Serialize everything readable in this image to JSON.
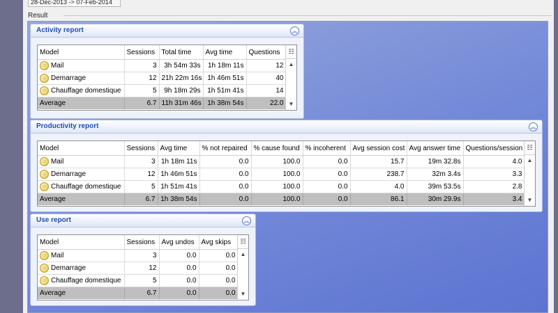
{
  "date_range": "28-Dec-2013 -> 07-Feb-2014",
  "result_label": "Result",
  "icons": {
    "collapse": "double-chevron-up-icon",
    "column_chooser": "column-chooser-icon",
    "model": "model-icon",
    "scroll_up": "arrow-up-icon",
    "scroll_down": "arrow-down-icon"
  },
  "activity": {
    "title": "Activity report",
    "columns": [
      "Model",
      "Sessions",
      "Total time",
      "Avg time",
      "Questions"
    ],
    "rows": [
      [
        "Mail",
        "3",
        "3h 54m 33s",
        "1h 18m 11s",
        "12"
      ],
      [
        "Demarrage",
        "12",
        "21h 22m 16s",
        "1h 46m 51s",
        "40"
      ],
      [
        "Chauffage domestique",
        "5",
        "9h 18m 29s",
        "1h 51m 41s",
        "14"
      ]
    ],
    "average": [
      "Average",
      "6.7",
      "11h 31m 46s",
      "1h 38m 54s",
      "22.0"
    ]
  },
  "productivity": {
    "title": "Productivity report",
    "columns": [
      "Model",
      "Sessions",
      "Avg time",
      "% not repaired",
      "% cause found",
      "% incoherent",
      "Avg session cost",
      "Avg answer time",
      "Questions/session"
    ],
    "rows": [
      [
        "Mail",
        "3",
        "1h 18m 11s",
        "0.0",
        "100.0",
        "0.0",
        "15.7",
        "19m 32.8s",
        "4.0"
      ],
      [
        "Demarrage",
        "12",
        "1h 46m 51s",
        "0.0",
        "100.0",
        "0.0",
        "238.7",
        "32m 3.4s",
        "3.3"
      ],
      [
        "Chauffage domestique",
        "5",
        "1h 51m 41s",
        "0.0",
        "100.0",
        "0.0",
        "4.0",
        "39m 53.5s",
        "2.8"
      ]
    ],
    "average": [
      "Average",
      "6.7",
      "1h 38m 54s",
      "0.0",
      "100.0",
      "0.0",
      "86.1",
      "30m 29.9s",
      "3.4"
    ]
  },
  "use": {
    "title": "Use report",
    "columns": [
      "Model",
      "Sessions",
      "Avg undos",
      "Avg skips"
    ],
    "rows": [
      [
        "Mail",
        "3",
        "0.0",
        "0.0"
      ],
      [
        "Demarrage",
        "12",
        "0.0",
        "0.0"
      ],
      [
        "Chauffage domestique",
        "5",
        "0.0",
        "0.0"
      ]
    ],
    "average": [
      "Average",
      "6.7",
      "0.0",
      "0.0"
    ]
  }
}
